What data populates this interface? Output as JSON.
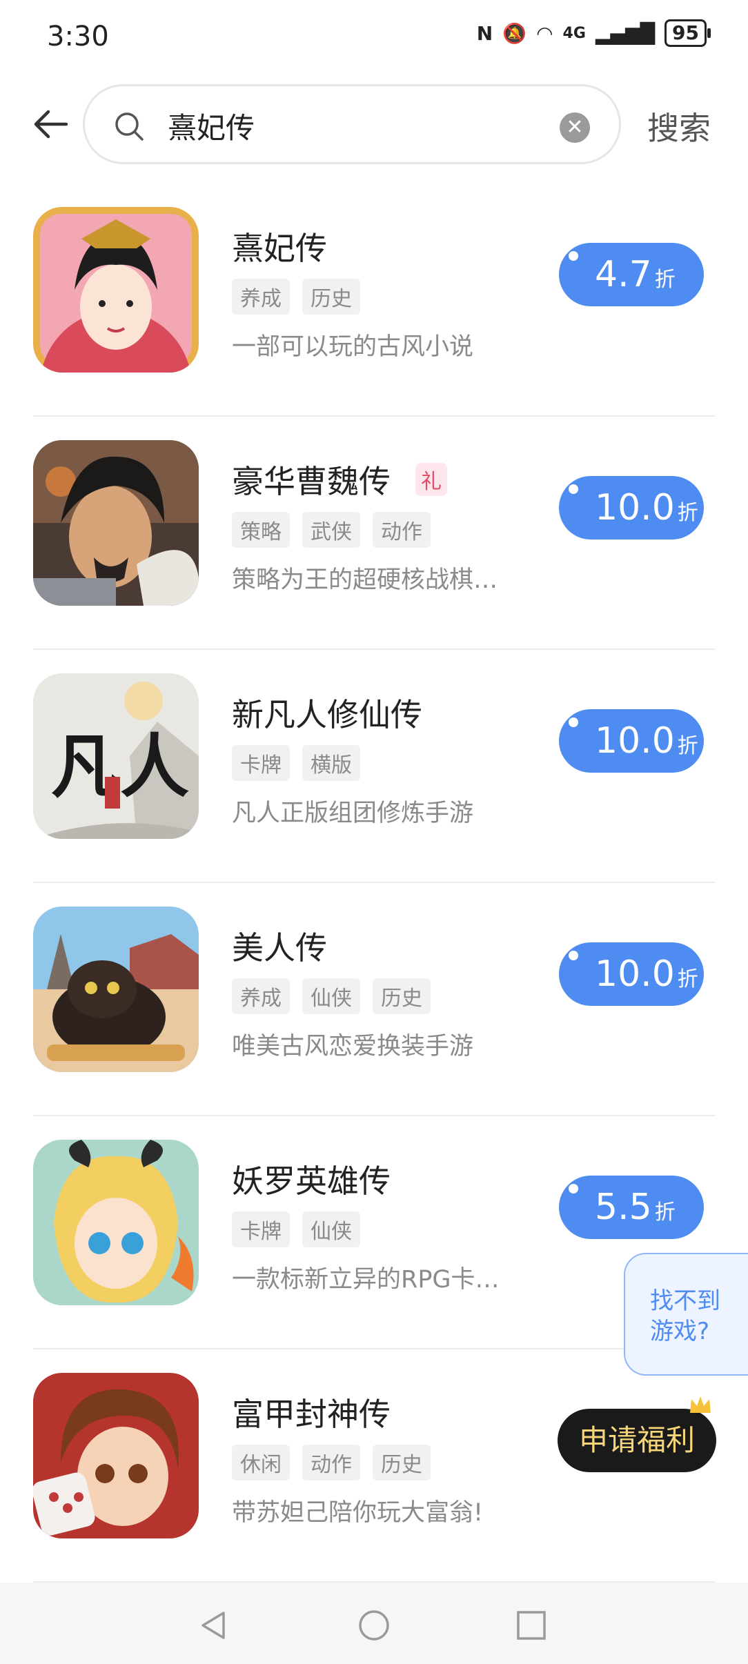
{
  "status_bar": {
    "time": "3:30",
    "network": "4G",
    "battery": "95"
  },
  "search": {
    "value": "熹妃传",
    "placeholder": "",
    "button_label": "搜索"
  },
  "games": [
    {
      "name": "熹妃传",
      "tags": [
        "养成",
        "历史"
      ],
      "desc": "一部可以玩的古风小说",
      "discount": "4.7",
      "unit": "折"
    },
    {
      "name": "豪华曹魏传",
      "badge": "礼",
      "tags": [
        "策略",
        "武侠",
        "动作"
      ],
      "desc": "策略为王的超硬核战棋…",
      "discount": "10.0",
      "unit": "折"
    },
    {
      "name": "新凡人修仙传",
      "tags": [
        "卡牌",
        "横版"
      ],
      "desc": "凡人正版组团修炼手游",
      "discount": "10.0",
      "unit": "折"
    },
    {
      "name": "美人传",
      "tags": [
        "养成",
        "仙侠",
        "历史"
      ],
      "desc": "唯美古风恋爱换装手游",
      "discount": "10.0",
      "unit": "折"
    },
    {
      "name": "妖罗英雄传",
      "tags": [
        "卡牌",
        "仙侠"
      ],
      "desc": "一款标新立异的RPG卡…",
      "discount": "5.5",
      "unit": "折"
    },
    {
      "name": "富甲封神传",
      "tags": [
        "休闲",
        "动作",
        "历史"
      ],
      "desc": "带苏妲己陪你玩大富翁!",
      "action_label": "申请福利"
    }
  ],
  "float_card": {
    "line1": "找不到",
    "line2": "游戏?"
  },
  "icon_text": {
    "fanren_big": "凡人"
  },
  "colors": {
    "accent": "#4f8cf2",
    "apply_bg": "#1a1a1a",
    "apply_text": "#f7d67a"
  }
}
